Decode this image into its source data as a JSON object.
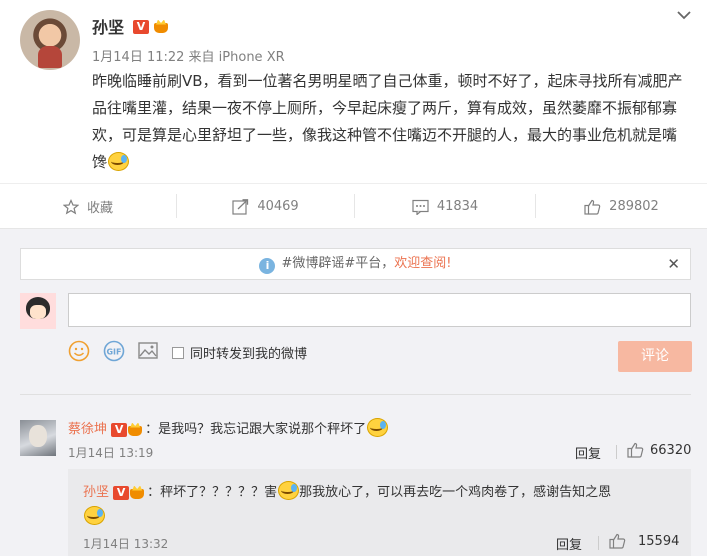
{
  "post": {
    "author": "孙坚",
    "verified_badge": "V",
    "meta": "1月14日 11:22 来自 iPhone XR",
    "text": "昨晚临睡前刷VB，看到一位著名男明星晒了自己体重，顿时不好了，起床寻找所有减肥产品往嘴里灌，结果一夜不停上厕所，今早起床瘦了两斤，算有成效，虽然萎靡不振郁郁寡欢，可是算是心里舒坦了一些，像我这种管不住嘴迈不开腿的人，最大的事业危机就是嘴馋"
  },
  "actions": {
    "favorite": "收藏",
    "repost": "40469",
    "comment": "41834",
    "like": "289802"
  },
  "notice": {
    "prefix": "#微博辟谣#平台，",
    "highlight": "欢迎查阅!",
    "close": "✕"
  },
  "composer": {
    "placeholder": "",
    "sync_label": "同时转发到我的微博",
    "submit": "评论"
  },
  "comments": [
    {
      "name": "蔡徐坤",
      "text": "：是我吗？我忘记跟大家说那个秤坏了",
      "time": "1月14日 13:19",
      "reply_label": "回复",
      "likes": "66320",
      "reply": {
        "name": "孙坚",
        "text_before": "：秤坏了？？？？？害",
        "text_after": "那我放心了，可以再去吃一个鸡肉卷了，感谢告知之恩",
        "time": "1月14日 13:32",
        "reply_label": "回复",
        "likes": "15594"
      }
    }
  ],
  "colors": {
    "name": "#eb7350",
    "submit_disabled": "#f7b8a1",
    "verified": "#e8492e",
    "background": "#f2f2f5"
  },
  "icons": [
    "chevron-down-icon",
    "star-icon",
    "repost-icon",
    "comment-icon",
    "thumbs-up-icon",
    "info-icon",
    "emoji-icon",
    "gif-icon",
    "image-icon",
    "close-icon"
  ]
}
